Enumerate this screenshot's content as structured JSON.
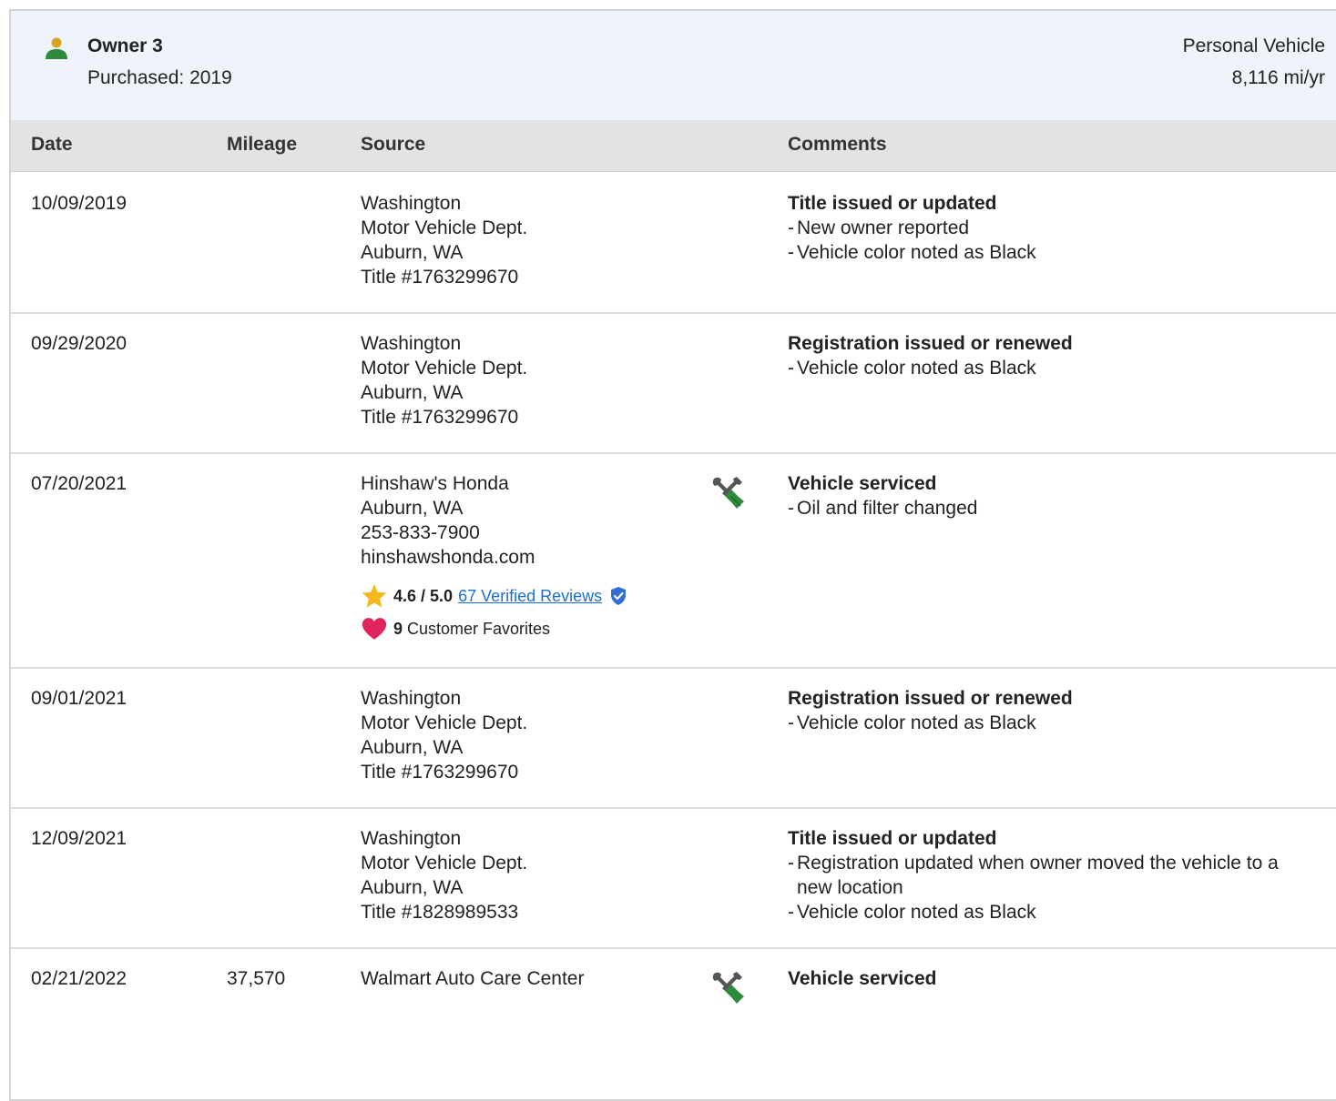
{
  "owner": {
    "name": "Owner 3",
    "purchased": "Purchased: 2019",
    "usage_type": "Personal Vehicle",
    "mileage_rate": "8,116 mi/yr"
  },
  "columns": {
    "date": "Date",
    "mileage": "Mileage",
    "source": "Source",
    "comments": "Comments"
  },
  "records": [
    {
      "date": "10/09/2019",
      "mileage": "",
      "source": [
        "Washington",
        "Motor Vehicle Dept.",
        "Auburn, WA",
        "Title #1763299670"
      ],
      "comment_title": "Title issued or updated",
      "comment_items": [
        "New owner reported",
        "Vehicle color noted as Black"
      ]
    },
    {
      "date": "09/29/2020",
      "mileage": "",
      "source": [
        "Washington",
        "Motor Vehicle Dept.",
        "Auburn, WA",
        "Title #1763299670"
      ],
      "comment_title": "Registration issued or renewed",
      "comment_items": [
        "Vehicle color noted as Black"
      ]
    },
    {
      "date": "07/20/2021",
      "mileage": "",
      "source": [
        "Hinshaw's Honda",
        "Auburn, WA",
        "253-833-7900",
        "hinshawshonda.com"
      ],
      "rating": "4.6 / 5.0",
      "reviews_link": "67 Verified Reviews",
      "favorites_count": "9",
      "favorites_label": "Customer Favorites",
      "service_icon": "service-tools-icon",
      "comment_title": "Vehicle serviced",
      "comment_items": [
        "Oil and filter changed"
      ]
    },
    {
      "date": "09/01/2021",
      "mileage": "",
      "source": [
        "Washington",
        "Motor Vehicle Dept.",
        "Auburn, WA",
        "Title #1763299670"
      ],
      "comment_title": "Registration issued or renewed",
      "comment_items": [
        "Vehicle color noted as Black"
      ]
    },
    {
      "date": "12/09/2021",
      "mileage": "",
      "source": [
        "Washington",
        "Motor Vehicle Dept.",
        "Auburn, WA",
        "Title #1828989533"
      ],
      "comment_title": "Title issued or updated",
      "comment_items": [
        "Registration updated when owner moved the vehicle to a new location",
        "Vehicle color noted as Black"
      ]
    },
    {
      "date": "02/21/2022",
      "mileage": "37,570",
      "source": [
        "Walmart Auto Care Center"
      ],
      "service_icon": "service-tools-icon",
      "comment_title": "Vehicle serviced",
      "comment_items": []
    }
  ],
  "colors": {
    "header_bg": "#eef4fa",
    "table_header_bg": "#e3e3e3",
    "owner_icon_head": "#d9a520",
    "owner_icon_body": "#2e8b3d",
    "link": "#1a6fd0",
    "star": "#f5b81c",
    "heart": "#e0245e",
    "shield": "#2f6fd6",
    "tools_gray": "#555555",
    "tools_green": "#2e8b3d"
  }
}
